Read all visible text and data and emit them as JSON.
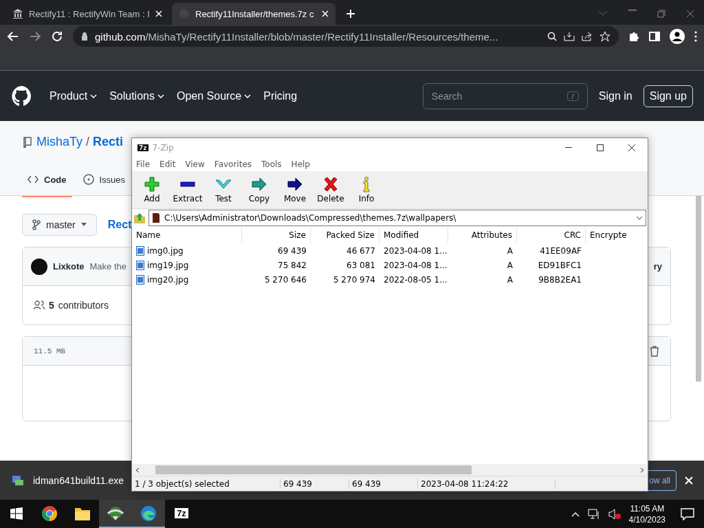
{
  "browser": {
    "tabs": [
      {
        "title": "Rectify11 : RectifyWin Team : I",
        "selected": false
      },
      {
        "title": "Rectify11Installer/themes.7z c",
        "selected": true
      }
    ],
    "url_host": "github.com",
    "url_path": "/MishaTy/Rectify11Installer/blob/master/Rectify11Installer/Resources/theme..."
  },
  "github": {
    "nav": [
      "Product",
      "Solutions",
      "Open Source",
      "Pricing"
    ],
    "search_placeholder": "Search",
    "search_key": "/",
    "sign_in": "Sign in",
    "sign_up": "Sign up",
    "repo_owner": "MishaTy",
    "repo_sep": "/",
    "repo_name": "Recti",
    "repo_tabs": [
      {
        "label": "Code",
        "selected": true
      },
      {
        "label": "Issues",
        "selected": false
      }
    ],
    "branch": "master",
    "path": "Rect",
    "commit_author": "Lixkote",
    "commit_message": "Make the",
    "history": "ry",
    "contributors_count": "5",
    "contributors_label": "contributors",
    "file_size": "11.5 MB"
  },
  "sevenzip": {
    "icon_label": "7z",
    "title": "7-Zip",
    "menu": [
      "File",
      "Edit",
      "View",
      "Favorites",
      "Tools",
      "Help"
    ],
    "toolbar": [
      {
        "label": "Add",
        "kind": "add"
      },
      {
        "label": "Extract",
        "kind": "extract"
      },
      {
        "label": "Test",
        "kind": "test"
      },
      {
        "label": "Copy",
        "kind": "copy"
      },
      {
        "label": "Move",
        "kind": "move"
      },
      {
        "label": "Delete",
        "kind": "delete"
      },
      {
        "label": "Info",
        "kind": "info"
      }
    ],
    "path": "C:\\Users\\Administrator\\Downloads\\Compressed\\themes.7z\\wallpapers\\",
    "columns": [
      "Name",
      "Size",
      "Packed Size",
      "Modified",
      "Attributes",
      "CRC",
      "Encrypte"
    ],
    "rows": [
      [
        "img0.jpg",
        "69 439",
        "46 677",
        "2023-04-08 1...",
        "A",
        "41EE09AF"
      ],
      [
        "img19.jpg",
        "75 842",
        "63 081",
        "2023-04-08 1...",
        "A",
        "ED91BFC1"
      ],
      [
        "img20.jpg",
        "5 270 646",
        "5 270 974",
        "2022-08-05 1...",
        "A",
        "9B8B2EA1"
      ]
    ],
    "status": [
      "1 / 3 object(s) selected",
      "69 439",
      "69 439",
      "2023-04-08 11:24:22"
    ]
  },
  "download": {
    "file": "idman641build11.exe",
    "show_all": "ow all"
  },
  "taskbar": {
    "apps": [
      {
        "kind": "chrome",
        "active": false
      },
      {
        "kind": "explorer",
        "active": false
      },
      {
        "kind": "idm",
        "active": true
      },
      {
        "kind": "edge",
        "active": true
      },
      {
        "kind": "sevenzip",
        "active": false
      }
    ],
    "sevenzip_label": "7z",
    "time": "11:05 AM",
    "date": "4/10/2023"
  }
}
